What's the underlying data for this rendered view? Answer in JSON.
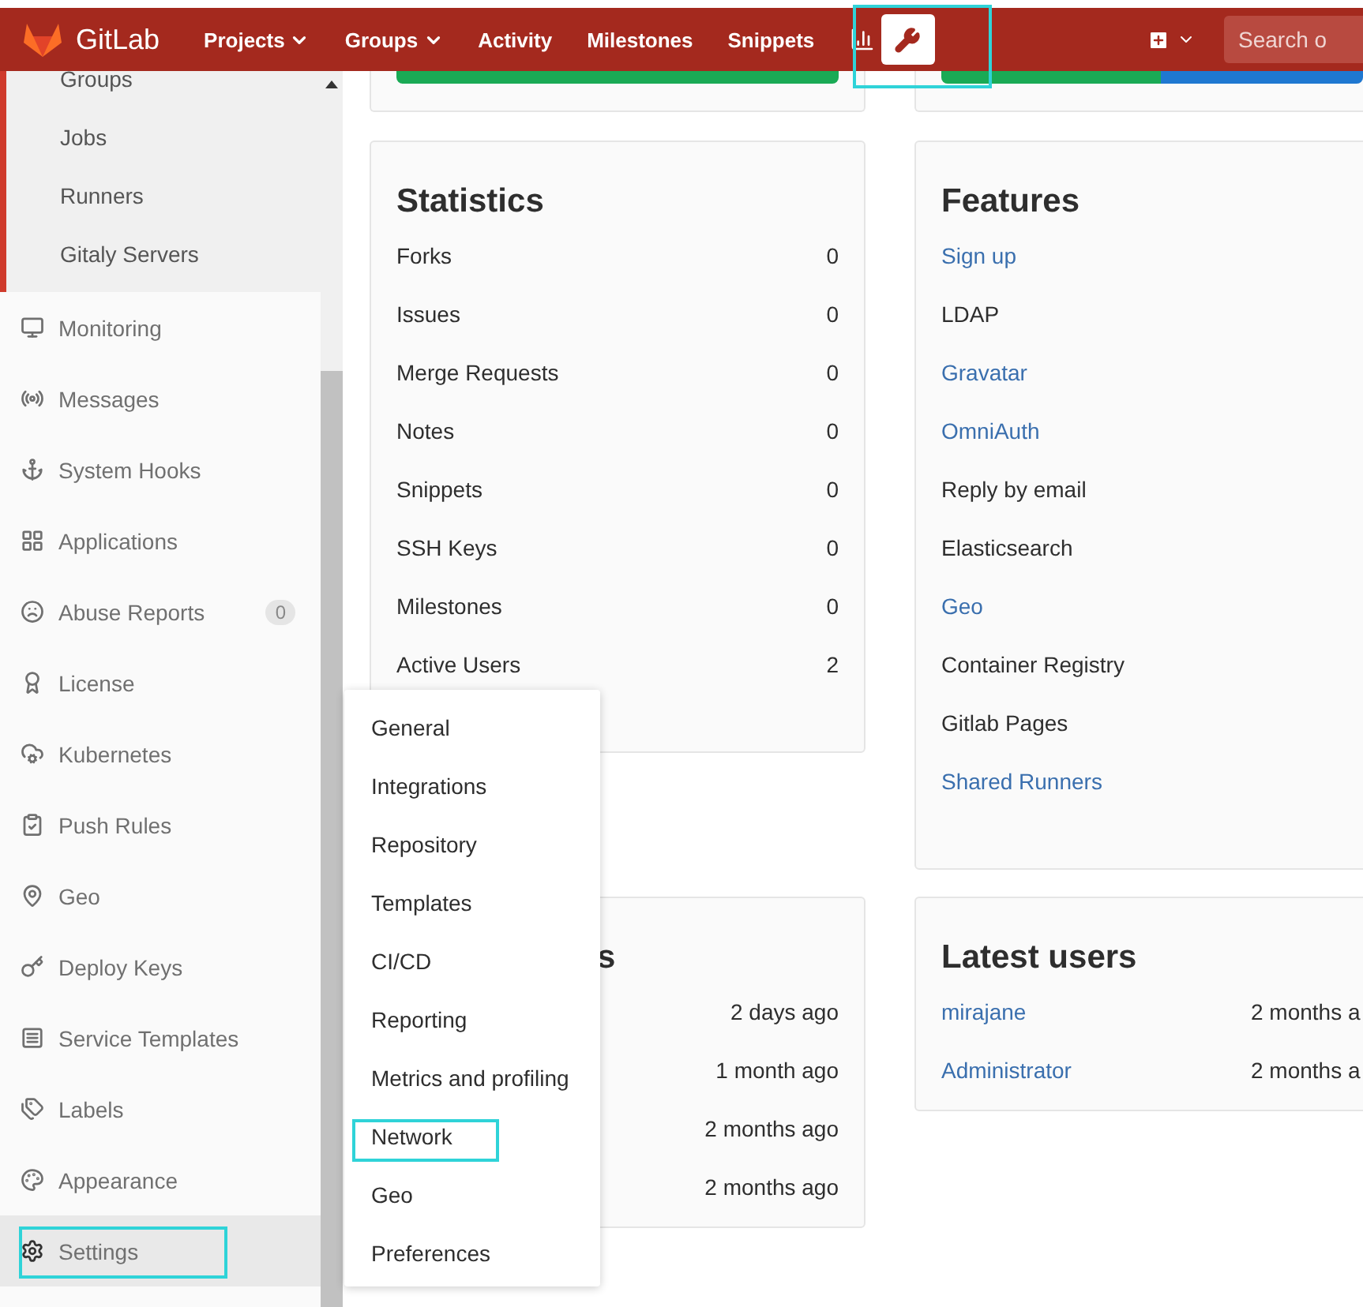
{
  "navbar": {
    "brand": "GitLab",
    "links": [
      {
        "label": "Projects",
        "dropdown": true
      },
      {
        "label": "Groups",
        "dropdown": true
      },
      {
        "label": "Activity",
        "dropdown": false
      },
      {
        "label": "Milestones",
        "dropdown": false
      },
      {
        "label": "Snippets",
        "dropdown": false
      }
    ],
    "admin_button": {
      "annotated": true
    },
    "search": {
      "placeholder": "Search o"
    }
  },
  "sidebar": {
    "subitems": [
      "Groups",
      "Jobs",
      "Runners",
      "Gitaly Servers"
    ],
    "items": [
      {
        "label": "Monitoring",
        "selected": false,
        "annotated": false
      },
      {
        "label": "Messages",
        "selected": false,
        "annotated": false
      },
      {
        "label": "System Hooks",
        "selected": false,
        "annotated": false
      },
      {
        "label": "Applications",
        "selected": false,
        "annotated": false
      },
      {
        "label": "Abuse Reports",
        "selected": false,
        "annotated": false,
        "badge": "0"
      },
      {
        "label": "License",
        "selected": false,
        "annotated": false
      },
      {
        "label": "Kubernetes",
        "selected": false,
        "annotated": false
      },
      {
        "label": "Push Rules",
        "selected": false,
        "annotated": false
      },
      {
        "label": "Geo",
        "selected": false,
        "annotated": false
      },
      {
        "label": "Deploy Keys",
        "selected": false,
        "annotated": false
      },
      {
        "label": "Service Templates",
        "selected": false,
        "annotated": false
      },
      {
        "label": "Labels",
        "selected": false,
        "annotated": false
      },
      {
        "label": "Appearance",
        "selected": false,
        "annotated": false
      },
      {
        "label": "Settings",
        "selected": true,
        "annotated": true
      }
    ]
  },
  "top_cards": [
    {
      "kind": "full",
      "color": "#1aaa55"
    },
    {
      "kind": "split",
      "bars": [
        {
          "level": 0.52,
          "color": "#1aaa55"
        },
        {
          "level": 0.48,
          "color": "#1f78d1"
        }
      ]
    }
  ],
  "statistics": {
    "title": "Statistics",
    "rows": [
      {
        "label": "Forks",
        "value": "0"
      },
      {
        "label": "Issues",
        "value": "0"
      },
      {
        "label": "Merge Requests",
        "value": "0"
      },
      {
        "label": "Notes",
        "value": "0"
      },
      {
        "label": "Snippets",
        "value": "0"
      },
      {
        "label": "SSH Keys",
        "value": "0"
      },
      {
        "label": "Milestones",
        "value": "0"
      },
      {
        "label": "Active Users",
        "value": "2"
      }
    ]
  },
  "features": {
    "title": "Features",
    "items": [
      {
        "label": "Sign up",
        "kind": "link"
      },
      {
        "label": "LDAP",
        "kind": "text"
      },
      {
        "label": "Gravatar",
        "kind": "link"
      },
      {
        "label": "OmniAuth",
        "kind": "link"
      },
      {
        "label": "Reply by email",
        "kind": "text"
      },
      {
        "label": "Elasticsearch",
        "kind": "text"
      },
      {
        "label": "Geo",
        "kind": "link"
      },
      {
        "label": "Container Registry",
        "kind": "text"
      },
      {
        "label": "Gitlab Pages",
        "kind": "text"
      },
      {
        "label": "Shared Runners",
        "kind": "link"
      }
    ]
  },
  "card_3": {
    "title": "s",
    "rows": [
      "2 days ago",
      "1 month ago",
      "2 months ago",
      "2 months ago"
    ]
  },
  "latest_users": {
    "title": "Latest users",
    "rows": [
      {
        "name": "mirajane",
        "time": "2 months a"
      },
      {
        "name": "Administrator",
        "time": "2 months a"
      }
    ]
  },
  "settings_menu": {
    "items": [
      {
        "label": "General",
        "annotated": false
      },
      {
        "label": "Integrations",
        "annotated": false
      },
      {
        "label": "Repository",
        "annotated": false
      },
      {
        "label": "Templates",
        "annotated": false
      },
      {
        "label": "CI/CD",
        "annotated": false
      },
      {
        "label": "Reporting",
        "annotated": false
      },
      {
        "label": "Metrics and profiling",
        "annotated": false
      },
      {
        "label": "Network",
        "annotated": true
      },
      {
        "label": "Geo",
        "annotated": false
      },
      {
        "label": "Preferences",
        "annotated": false
      }
    ]
  }
}
